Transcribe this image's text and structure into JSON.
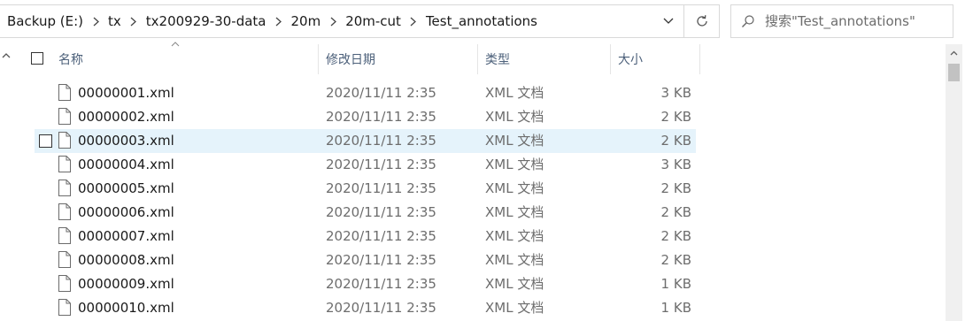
{
  "address_bar": {
    "crumbs": [
      "Backup (E:)",
      "tx",
      "tx200929-30-data",
      "20m",
      "20m-cut",
      "Test_annotations"
    ]
  },
  "search": {
    "placeholder": "搜索\"Test_annotations\""
  },
  "columns": {
    "name": "名称",
    "modified": "修改日期",
    "type": "类型",
    "size": "大小"
  },
  "rows": [
    {
      "name": "00000001.xml",
      "modified": "2020/11/11 2:35",
      "type": "XML 文档",
      "size": "3 KB"
    },
    {
      "name": "00000002.xml",
      "modified": "2020/11/11 2:35",
      "type": "XML 文档",
      "size": "2 KB"
    },
    {
      "name": "00000003.xml",
      "modified": "2020/11/11 2:35",
      "type": "XML 文档",
      "size": "2 KB"
    },
    {
      "name": "00000004.xml",
      "modified": "2020/11/11 2:35",
      "type": "XML 文档",
      "size": "3 KB"
    },
    {
      "name": "00000005.xml",
      "modified": "2020/11/11 2:35",
      "type": "XML 文档",
      "size": "2 KB"
    },
    {
      "name": "00000006.xml",
      "modified": "2020/11/11 2:35",
      "type": "XML 文档",
      "size": "2 KB"
    },
    {
      "name": "00000007.xml",
      "modified": "2020/11/11 2:35",
      "type": "XML 文档",
      "size": "2 KB"
    },
    {
      "name": "00000008.xml",
      "modified": "2020/11/11 2:35",
      "type": "XML 文档",
      "size": "2 KB"
    },
    {
      "name": "00000009.xml",
      "modified": "2020/11/11 2:35",
      "type": "XML 文档",
      "size": "1 KB"
    },
    {
      "name": "00000010.xml",
      "modified": "2020/11/11 2:35",
      "type": "XML 文档",
      "size": "1 KB"
    }
  ],
  "hovered_row_index": 2,
  "icons": {
    "crumb_separator": "chevron-right-icon",
    "history_dropdown": "chevron-down-icon",
    "refresh": "refresh-icon",
    "search": "search-icon",
    "file": "document-icon",
    "sort": "sort-ascending-icon"
  },
  "colors": {
    "hover_row": "#e5f3fb",
    "header_text": "#4c607a",
    "secondary_text": "#6d6d6d"
  }
}
